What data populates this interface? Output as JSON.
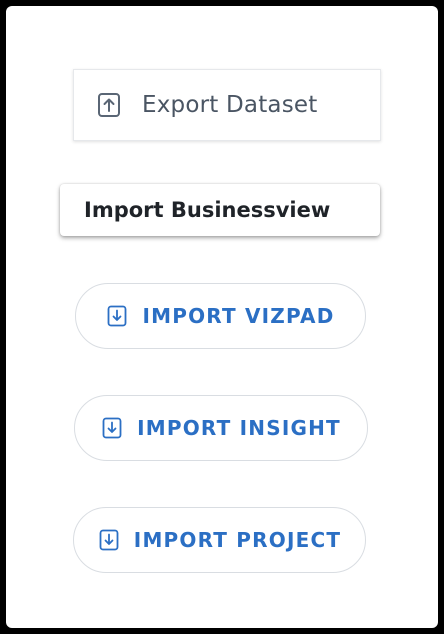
{
  "colors": {
    "frame": "#000000",
    "background": "#ffffff",
    "export_text": "#4a5563",
    "import_accent": "#2b6fc4",
    "businessview_text": "#1f2328"
  },
  "buttons": {
    "export_dataset": {
      "label": "Export Dataset",
      "icon": "upload-file-icon"
    },
    "import_businessview": {
      "label": "Import Businessview"
    },
    "import_vizpad": {
      "label": "IMPORT VIZPAD",
      "icon": "download-file-icon"
    },
    "import_insight": {
      "label": "IMPORT INSIGHT",
      "icon": "download-file-icon"
    },
    "import_project": {
      "label": "IMPORT PROJECT",
      "icon": "download-file-icon"
    }
  }
}
